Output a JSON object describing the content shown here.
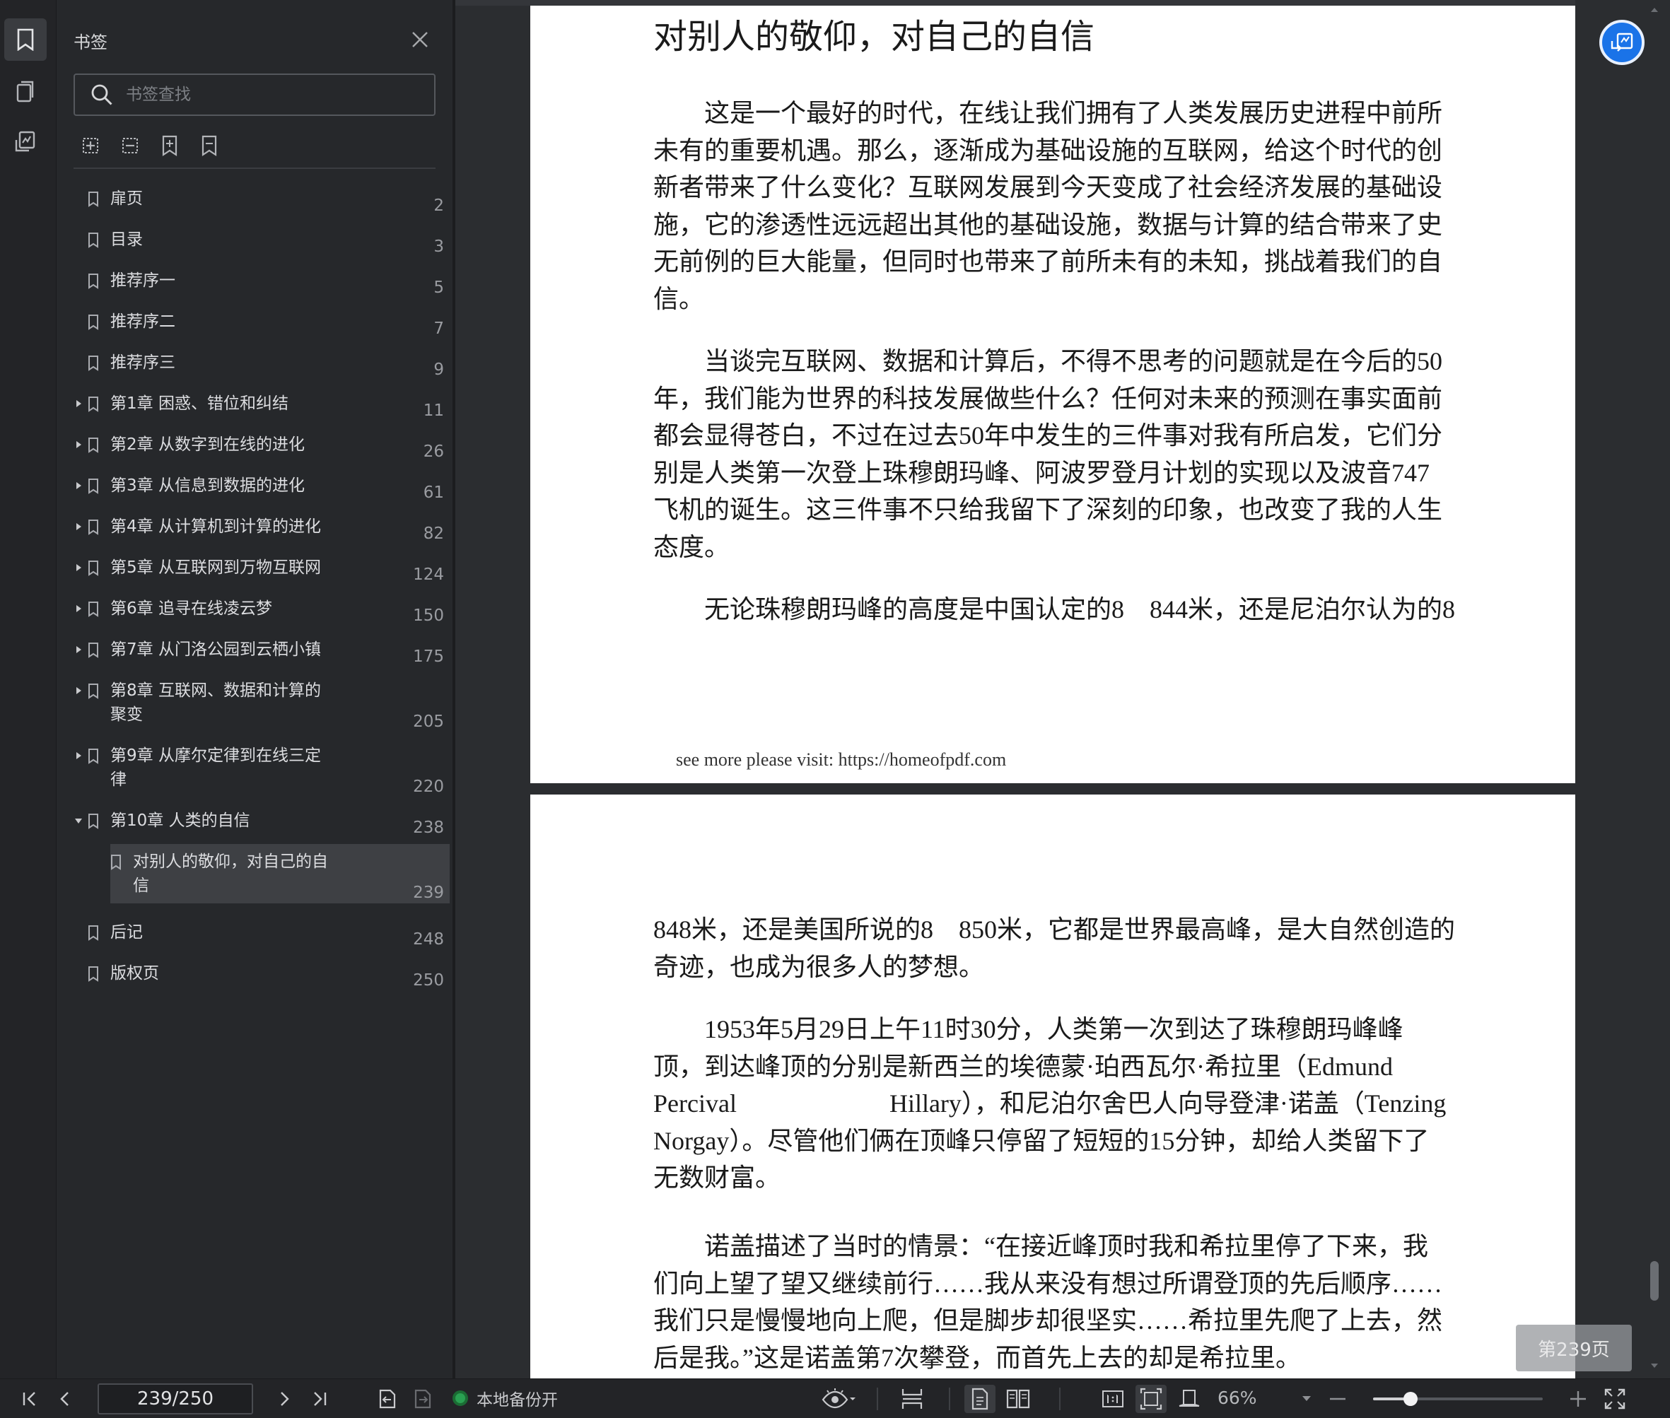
{
  "sidebar": {
    "title": "书签",
    "search_placeholder": "书签查找",
    "bookmarks": [
      {
        "label": "扉页",
        "label2": "",
        "page": "2",
        "expandable": false,
        "expanded": false,
        "level": 0,
        "selected": false
      },
      {
        "label": "目录",
        "label2": "",
        "page": "3",
        "expandable": false,
        "expanded": false,
        "level": 0,
        "selected": false
      },
      {
        "label": "推荐序一",
        "label2": "",
        "page": "5",
        "expandable": false,
        "expanded": false,
        "level": 0,
        "selected": false
      },
      {
        "label": "推荐序二",
        "label2": "",
        "page": "7",
        "expandable": false,
        "expanded": false,
        "level": 0,
        "selected": false
      },
      {
        "label": "推荐序三",
        "label2": "",
        "page": "9",
        "expandable": false,
        "expanded": false,
        "level": 0,
        "selected": false
      },
      {
        "label": "第1章 困惑、错位和纠结",
        "label2": "",
        "page": "11",
        "expandable": true,
        "expanded": false,
        "level": 0,
        "selected": false
      },
      {
        "label": "第2章 从数字到在线的进化",
        "label2": "",
        "page": "26",
        "expandable": true,
        "expanded": false,
        "level": 0,
        "selected": false
      },
      {
        "label": "第3章 从信息到数据的进化",
        "label2": "",
        "page": "61",
        "expandable": true,
        "expanded": false,
        "level": 0,
        "selected": false
      },
      {
        "label": "第4章 从计算机到计算的进化",
        "label2": "",
        "page": "82",
        "expandable": true,
        "expanded": false,
        "level": 0,
        "selected": false
      },
      {
        "label": "第5章 从互联网到万物互联网",
        "label2": "",
        "page": "124",
        "expandable": true,
        "expanded": false,
        "level": 0,
        "selected": false
      },
      {
        "label": "第6章 追寻在线凌云梦",
        "label2": "",
        "page": "150",
        "expandable": true,
        "expanded": false,
        "level": 0,
        "selected": false
      },
      {
        "label": "第7章 从门洛公园到云栖小镇",
        "label2": "",
        "page": "175",
        "expandable": true,
        "expanded": false,
        "level": 0,
        "selected": false
      },
      {
        "label": "第8章 互联网、数据和计算的",
        "label2": "聚变",
        "page": "205",
        "expandable": true,
        "expanded": false,
        "level": 0,
        "selected": false
      },
      {
        "label": "第9章 从摩尔定律到在线三定",
        "label2": "律",
        "page": "220",
        "expandable": true,
        "expanded": false,
        "level": 0,
        "selected": false
      },
      {
        "label": "第10章 人类的自信",
        "label2": "",
        "page": "238",
        "expandable": true,
        "expanded": true,
        "level": 0,
        "selected": false
      },
      {
        "label": "对别人的敬仰，对自己的自",
        "label2": "信",
        "page": "239",
        "expandable": false,
        "expanded": false,
        "level": 1,
        "selected": true
      },
      {
        "label": "后记",
        "label2": "",
        "page": "248",
        "expandable": false,
        "expanded": false,
        "level": 0,
        "selected": false
      },
      {
        "label": "版权页",
        "label2": "",
        "page": "250",
        "expandable": false,
        "expanded": false,
        "level": 0,
        "selected": false
      }
    ]
  },
  "page1": {
    "heading": "对别人的敬仰，对自己的自信",
    "p1": [
      "　　这是一个最好的时代，在线让我们拥有了人类发展历史进程中前所",
      "未有的重要机遇。那么，逐渐成为基础设施的互联网，给这个时代的创",
      "新者带来了什么变化？互联网发展到今天变成了社会经济发展的基础设",
      "施，它的渗透性远远超出其他的基础设施，数据与计算的结合带来了史",
      "无前例的巨大能量，但同时也带来了前所未有的未知，挑战着我们的自",
      "信。"
    ],
    "p2": [
      "　　当谈完互联网、数据和计算后，不得不思考的问题就是在今后的50",
      "年，我们能为世界的科技发展做些什么？任何对未来的预测在事实面前",
      "都会显得苍白，不过在过去50年中发生的三件事对我有所启发，它们分",
      "别是人类第一次登上珠穆朗玛峰、阿波罗登月计划的实现以及波音747",
      "飞机的诞生。这三件事不只给我留下了深刻的印象，也改变了我的人生",
      "态度。"
    ],
    "p3": [
      "　　无论珠穆朗玛峰的高度是中国认定的8　844米，还是尼泊尔认为的8"
    ],
    "footer": "see more please visit: https://homeofpdf.com"
  },
  "page2": {
    "p1": [
      "848米，还是美国所说的8　850米，它都是世界最高峰，是大自然创造的",
      "奇迹，也成为很多人的梦想。"
    ],
    "p2": [
      "　　1953年5月29日上午11时30分，人类第一次到达了珠穆朗玛峰峰",
      "顶，到达峰顶的分别是新西兰的埃德蒙·珀西瓦尔·希拉里（Edmund",
      "Percival　　　　　　Hillary），和尼泊尔舍巴人向导登津·诺盖（Tenzing",
      "Norgay）。尽管他们俩在顶峰只停留了短短的15分钟，却给人类留下了",
      "无数财富。"
    ],
    "p3": [
      "　　诺盖描述了当时的情景：“在接近峰顶时我和希拉里停了下来，我",
      "们向上望了望又继续前行……我从来没有想过所谓登顶的先后顺序……",
      "我们只是慢慢地向上爬，但是脚步却很坚实……希拉里先爬了上去，然",
      "后是我。”这是诺盖第7次攀登，而首先上去的却是希拉里。"
    ]
  },
  "page_badge": "第239页",
  "toolbar": {
    "page_value": "239/250",
    "backup_label": "本地备份开",
    "zoom_label": "66%",
    "zoom_fraction": 0.22,
    "backup_status_color": "#2aa152",
    "accent_color": "#1a73e8"
  }
}
